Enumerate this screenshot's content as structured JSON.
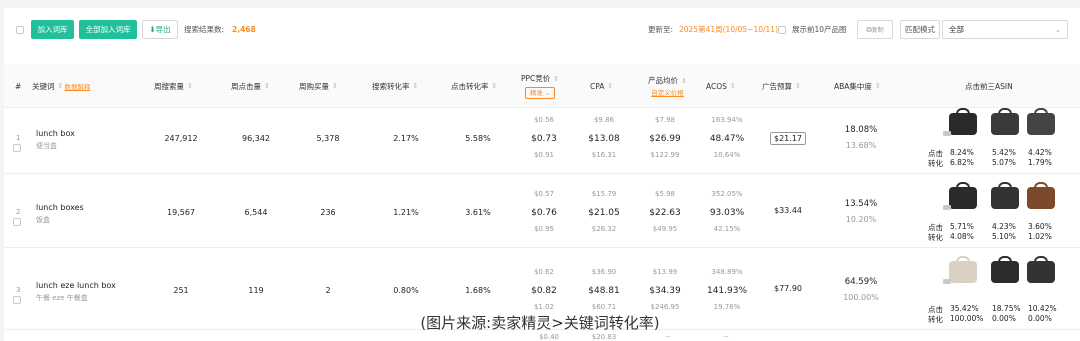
{
  "toolbar": {
    "add_label": "加入词库",
    "add_all_label": "全部加入词库",
    "export_label": "导出",
    "result_label": "搜索结果数:",
    "result_count": "2,468",
    "updated_label": "更新至:",
    "updated_value": "2025第41周(10/05~10/11)",
    "top10_label": "展示前10产品图",
    "copy_label": "复制",
    "match_label": "匹配模式",
    "match_value": "全部"
  },
  "header": {
    "index": "#",
    "keyword": "关键词",
    "keyword_link": "数据解释",
    "weekly_search": "周搜索量",
    "weekly_clicks": "周点击量",
    "weekly_purchase": "周购买量",
    "search_cvr": "搜索转化率",
    "ctr": "点击转化率",
    "ppc": "PPC竞价",
    "ppc_select": "精准",
    "cpa": "CPA",
    "avg_price": "产品均价",
    "avg_price_link": "自定义价格",
    "acos": "ACOS",
    "budget": "广告预算",
    "aba": "ABA集中度",
    "top3": "点击前三ASIN"
  },
  "rows": [
    {
      "index": "1",
      "keyword": "lunch box",
      "translation": "便当盒",
      "weekly_search": "247,912",
      "weekly_clicks": "96,342",
      "weekly_purchase": "5,378",
      "search_cvr": "2.17%",
      "ctr": "5.58%",
      "ppc": [
        "$0.56",
        "$0.73",
        "$0.91"
      ],
      "cpa": [
        "$9.86",
        "$13.08",
        "$16.31"
      ],
      "price": [
        "$7.98",
        "$26.99",
        "$122.99"
      ],
      "acos": [
        "163.94%",
        "48.47%",
        "10.64%"
      ],
      "budget": "$21.17",
      "aba": [
        "18.08%",
        "13.68%"
      ],
      "click_label": "点击",
      "conv_label": "转化",
      "asin_click": [
        "8.24%",
        "5.42%",
        "4.42%"
      ],
      "asin_conv": [
        "6.82%",
        "5.07%",
        "1.79%"
      ]
    },
    {
      "index": "2",
      "keyword": "lunch boxes",
      "translation": "饭盒",
      "weekly_search": "19,567",
      "weekly_clicks": "6,544",
      "weekly_purchase": "236",
      "search_cvr": "1.21%",
      "ctr": "3.61%",
      "ppc": [
        "$0.57",
        "$0.76",
        "$0.95"
      ],
      "cpa": [
        "$15.79",
        "$21.05",
        "$26.32"
      ],
      "price": [
        "$5.98",
        "$22.63",
        "$49.95"
      ],
      "acos": [
        "352.05%",
        "93.03%",
        "42.15%"
      ],
      "budget": "$33.44",
      "aba": [
        "13.54%",
        "10.20%"
      ],
      "click_label": "点击",
      "conv_label": "转化",
      "asin_click": [
        "5.71%",
        "4.23%",
        "3.60%"
      ],
      "asin_conv": [
        "4.08%",
        "5.10%",
        "1.02%"
      ]
    },
    {
      "index": "3",
      "keyword": "lunch eze lunch box",
      "translation": "午餐 eze 午餐盒",
      "weekly_search": "251",
      "weekly_clicks": "119",
      "weekly_purchase": "2",
      "search_cvr": "0.80%",
      "ctr": "1.68%",
      "ppc": [
        "$0.62",
        "$0.82",
        "$1.02"
      ],
      "cpa": [
        "$36.90",
        "$48.81",
        "$60.71"
      ],
      "price": [
        "$13.99",
        "$34.39",
        "$246.95"
      ],
      "acos": [
        "348.89%",
        "141.93%",
        "19.76%"
      ],
      "budget": "$77.90",
      "aba": [
        "64.59%",
        "100.00%"
      ],
      "click_label": "点击",
      "conv_label": "转化",
      "asin_click": [
        "35.42%",
        "18.75%",
        "10.42%"
      ],
      "asin_conv": [
        "100.00%",
        "0.00%",
        "0.00%"
      ]
    }
  ],
  "partial_row": {
    "ppc_top": "$0.40",
    "cpa_top": "$20.83",
    "price_top": "--",
    "acos_top": "--"
  },
  "watermark": "(图片来源:卖家精灵>关键词转化率)",
  "colors": {
    "accent": "#20c19a",
    "orange": "#ff8a1f"
  }
}
